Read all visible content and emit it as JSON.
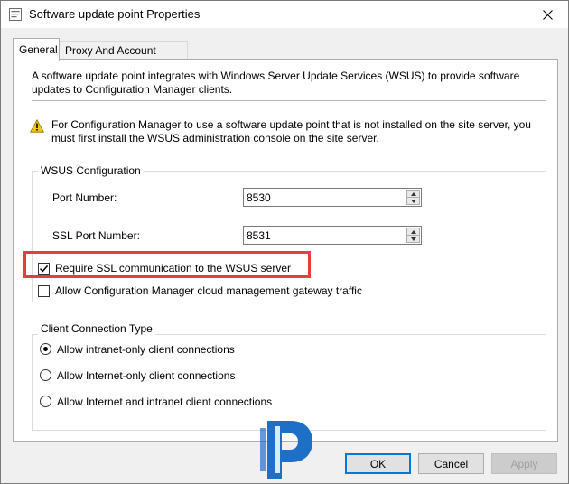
{
  "window": {
    "title": "Software update point Properties"
  },
  "tabs": [
    {
      "label": "General",
      "active": true
    },
    {
      "label": "Proxy And Account Settings",
      "active": false
    }
  ],
  "general": {
    "description": "A software update point integrates with Windows Server Update Services (WSUS) to provide software updates to Configuration Manager clients.",
    "warning": "For Configuration Manager to use a software update point that is not installed on the site server, you must first install the WSUS administration console on the site server.",
    "wsus": {
      "group_title": "WSUS Configuration",
      "port_label": "Port Number:",
      "port_value": "8530",
      "ssl_port_label": "SSL Port Number:",
      "ssl_port_value": "8531",
      "require_ssl_label": "Require SSL communication to the WSUS server",
      "require_ssl_checked": true,
      "allow_cmg_label": "Allow Configuration Manager cloud management gateway traffic",
      "allow_cmg_checked": false
    },
    "client_connection": {
      "group_title": "Client Connection Type",
      "options": [
        {
          "label": "Allow intranet-only client connections",
          "selected": true
        },
        {
          "label": "Allow Internet-only client connections",
          "selected": false
        },
        {
          "label": "Allow Internet and intranet client connections",
          "selected": false
        }
      ]
    }
  },
  "buttons": {
    "ok": "OK",
    "cancel": "Cancel",
    "apply": "Apply"
  },
  "colors": {
    "highlight_border": "#e0413d",
    "logo_blue": "#1e6fc6",
    "default_button_border": "#0078d7"
  }
}
